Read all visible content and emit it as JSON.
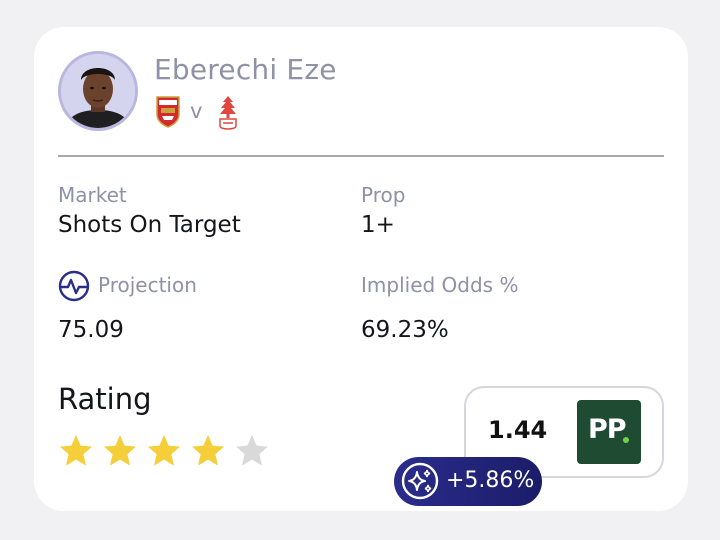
{
  "player": {
    "name": "Eberechi Eze",
    "home_team": "Arsenal",
    "versus": "v",
    "away_team": "Nottingham Forest"
  },
  "bet": {
    "market_label": "Market",
    "market_value": "Shots On Target",
    "prop_label": "Prop",
    "prop_value": "1+",
    "projection_label": "Projection",
    "projection_value": "75.09",
    "implied_label": "Implied Odds %",
    "implied_value": "69.23%"
  },
  "rating": {
    "label": "Rating",
    "stars_filled": 4,
    "stars_total": 5
  },
  "odds": {
    "value": "1.44",
    "bookmaker": "PP",
    "bookmaker_logo_text": "PP"
  },
  "edge": {
    "value": "+5.86%"
  },
  "colors": {
    "accent": "#2a2d8c",
    "star_filled": "#f5cf3a",
    "star_empty": "#d9d9d9",
    "bookmaker_green": "#1e4b31",
    "home_red": "#d6282f",
    "away_red": "#e0463f"
  },
  "icons": {
    "projection": "pulse-icon",
    "edge": "sparkles-icon",
    "star": "star-icon"
  }
}
